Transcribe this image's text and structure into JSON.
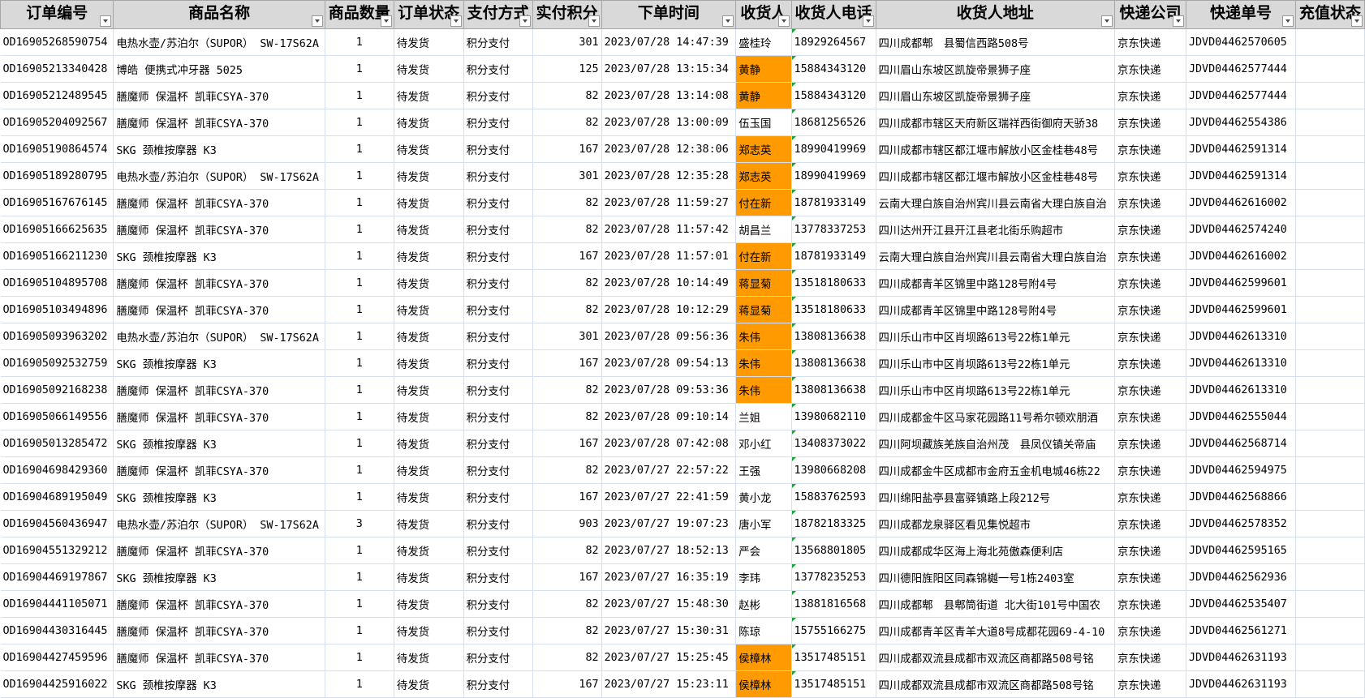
{
  "table": {
    "headers": [
      "订单编号",
      "商品名称",
      "商品数量",
      "订单状态",
      "支付方式",
      "实付积分",
      "下单时间",
      "收货人",
      "收货人电话",
      "收货人地址",
      "快递公司",
      "快递单号",
      "充值状态"
    ],
    "rows": [
      [
        "OD16905268590754",
        "电热水壶/苏泊尔（SUPOR） SW-17S62A",
        "1",
        "待发货",
        "积分支付",
        "301",
        "2023/07/28 14:47:39",
        "盛桂玲",
        "18929264567",
        "四川成都郫　县蜀信西路508号",
        "京东快递",
        "JDVD04462570605",
        ""
      ],
      [
        "OD16905213340428",
        "博皓 便携式冲牙器 5025",
        "1",
        "待发货",
        "积分支付",
        "125",
        "2023/07/28 13:15:34",
        "黄静",
        "15884343120",
        "四川眉山东坡区凯旋帝景狮子座",
        "京东快递",
        "JDVD04462577444",
        ""
      ],
      [
        "OD16905212489545",
        "膳魔师 保温杯 凯菲CSYA-370",
        "1",
        "待发货",
        "积分支付",
        "82",
        "2023/07/28 13:14:08",
        "黄静",
        "15884343120",
        "四川眉山东坡区凯旋帝景狮子座",
        "京东快递",
        "JDVD04462577444",
        ""
      ],
      [
        "OD16905204092567",
        "膳魔师 保温杯 凯菲CSYA-370",
        "1",
        "待发货",
        "积分支付",
        "82",
        "2023/07/28 13:00:09",
        "伍玉国",
        "18681256526",
        "四川成都市辖区天府新区瑞祥西街御府天骄38",
        "京东快递",
        "JDVD04462554386",
        ""
      ],
      [
        "OD16905190864574",
        "SKG 颈椎按摩器 K3",
        "1",
        "待发货",
        "积分支付",
        "167",
        "2023/07/28 12:38:06",
        "郑志英",
        "18990419969",
        "四川成都市辖区都江堰市解放小区金桂巷48号",
        "京东快递",
        "JDVD04462591314",
        ""
      ],
      [
        "OD16905189280795",
        "电热水壶/苏泊尔（SUPOR） SW-17S62A",
        "1",
        "待发货",
        "积分支付",
        "301",
        "2023/07/28 12:35:28",
        "郑志英",
        "18990419969",
        "四川成都市辖区都江堰市解放小区金桂巷48号",
        "京东快递",
        "JDVD04462591314",
        ""
      ],
      [
        "OD16905167676145",
        "膳魔师 保温杯 凯菲CSYA-370",
        "1",
        "待发货",
        "积分支付",
        "82",
        "2023/07/28 11:59:27",
        "付在新",
        "18781933149",
        "云南大理白族自治州宾川县云南省大理白族自治",
        "京东快递",
        "JDVD04462616002",
        ""
      ],
      [
        "OD16905166625635",
        "膳魔师 保温杯 凯菲CSYA-370",
        "1",
        "待发货",
        "积分支付",
        "82",
        "2023/07/28 11:57:42",
        "胡昌兰",
        "13778337253",
        "四川达州开江县开江县老北街乐购超市",
        "京东快递",
        "JDVD04462574240",
        ""
      ],
      [
        "OD16905166211230",
        "SKG 颈椎按摩器 K3",
        "1",
        "待发货",
        "积分支付",
        "167",
        "2023/07/28 11:57:01",
        "付在新",
        "18781933149",
        "云南大理白族自治州宾川县云南省大理白族自治",
        "京东快递",
        "JDVD04462616002",
        ""
      ],
      [
        "OD16905104895708",
        "膳魔师 保温杯 凯菲CSYA-370",
        "1",
        "待发货",
        "积分支付",
        "82",
        "2023/07/28 10:14:49",
        "蒋显菊",
        "13518180633",
        "四川成都青羊区锦里中路128号附4号",
        "京东快递",
        "JDVD04462599601",
        ""
      ],
      [
        "OD16905103494896",
        "膳魔师 保温杯 凯菲CSYA-370",
        "1",
        "待发货",
        "积分支付",
        "82",
        "2023/07/28 10:12:29",
        "蒋显菊",
        "13518180633",
        "四川成都青羊区锦里中路128号附4号",
        "京东快递",
        "JDVD04462599601",
        ""
      ],
      [
        "OD16905093963202",
        "电热水壶/苏泊尔（SUPOR） SW-17S62A",
        "1",
        "待发货",
        "积分支付",
        "301",
        "2023/07/28 09:56:36",
        "朱伟",
        "13808136638",
        "四川乐山市中区肖坝路613号22栋1单元",
        "京东快递",
        "JDVD04462613310",
        ""
      ],
      [
        "OD16905092532759",
        "SKG 颈椎按摩器 K3",
        "1",
        "待发货",
        "积分支付",
        "167",
        "2023/07/28 09:54:13",
        "朱伟",
        "13808136638",
        "四川乐山市中区肖坝路613号22栋1单元",
        "京东快递",
        "JDVD04462613310",
        ""
      ],
      [
        "OD16905092168238",
        "膳魔师 保温杯 凯菲CSYA-370",
        "1",
        "待发货",
        "积分支付",
        "82",
        "2023/07/28 09:53:36",
        "朱伟",
        "13808136638",
        "四川乐山市中区肖坝路613号22栋1单元",
        "京东快递",
        "JDVD04462613310",
        ""
      ],
      [
        "OD16905066149556",
        "膳魔师 保温杯 凯菲CSYA-370",
        "1",
        "待发货",
        "积分支付",
        "82",
        "2023/07/28 09:10:14",
        "兰姐",
        "13980682110",
        "四川成都金牛区马家花园路11号希尔顿欢朋酒",
        "京东快递",
        "JDVD04462555044",
        ""
      ],
      [
        "OD16905013285472",
        "SKG 颈椎按摩器 K3",
        "1",
        "待发货",
        "积分支付",
        "167",
        "2023/07/28 07:42:08",
        "邓小红",
        "13408373022",
        "四川阿坝藏族羌族自治州茂　县凤仪镇关帝庙",
        "京东快递",
        "JDVD04462568714",
        ""
      ],
      [
        "OD16904698429360",
        "膳魔师 保温杯 凯菲CSYA-370",
        "1",
        "待发货",
        "积分支付",
        "82",
        "2023/07/27 22:57:22",
        "王强",
        "13980668208",
        "四川成都金牛区成都市金府五金机电城46栋22",
        "京东快递",
        "JDVD04462594975",
        ""
      ],
      [
        "OD16904689195049",
        "SKG 颈椎按摩器 K3",
        "1",
        "待发货",
        "积分支付",
        "167",
        "2023/07/27 22:41:59",
        "黄小龙",
        "15883762593",
        "四川绵阳盐亭县富驿镇路上段212号",
        "京东快递",
        "JDVD04462568866",
        ""
      ],
      [
        "OD16904560436947",
        "电热水壶/苏泊尔（SUPOR） SW-17S62A",
        "3",
        "待发货",
        "积分支付",
        "903",
        "2023/07/27 19:07:23",
        "唐小军",
        "18782183325",
        "四川成都龙泉驿区看见集悦超市",
        "京东快递",
        "JDVD04462578352",
        ""
      ],
      [
        "OD16904551329212",
        "膳魔师 保温杯 凯菲CSYA-370",
        "1",
        "待发货",
        "积分支付",
        "82",
        "2023/07/27 18:52:13",
        "严会",
        "13568801805",
        "四川成都成华区海上海北苑傲森便利店",
        "京东快递",
        "JDVD04462595165",
        ""
      ],
      [
        "OD16904469197867",
        "SKG 颈椎按摩器 K3",
        "1",
        "待发货",
        "积分支付",
        "167",
        "2023/07/27 16:35:19",
        "李玮",
        "13778235253",
        "四川德阳旌阳区同森锦樾一号1栋2403室",
        "京东快递",
        "JDVD04462562936",
        ""
      ],
      [
        "OD16904441105071",
        "膳魔师 保温杯 凯菲CSYA-370",
        "1",
        "待发货",
        "积分支付",
        "82",
        "2023/07/27 15:48:30",
        "赵彬",
        "13881816568",
        "四川成都郫　县郫筒街道 北大街101号中国农",
        "京东快递",
        "JDVD04462535407",
        ""
      ],
      [
        "OD16904430316445",
        "膳魔师 保温杯 凯菲CSYA-370",
        "1",
        "待发货",
        "积分支付",
        "82",
        "2023/07/27 15:30:31",
        "陈琼",
        "15755166275",
        "四川成都青羊区青羊大道8号成都花园69-4-10",
        "京东快递",
        "JDVD04462561271",
        ""
      ],
      [
        "OD16904427459596",
        "膳魔师 保温杯 凯菲CSYA-370",
        "1",
        "待发货",
        "积分支付",
        "82",
        "2023/07/27 15:25:45",
        "侯樟林",
        "13517485151",
        "四川成都双流县成都市双流区商都路508号铭",
        "京东快递",
        "JDVD04462631193",
        ""
      ],
      [
        "OD16904425916022",
        "SKG 颈椎按摩器 K3",
        "1",
        "待发货",
        "积分支付",
        "167",
        "2023/07/27 15:23:11",
        "侯樟林",
        "13517485151",
        "四川成都双流县成都市双流区商都路508号铭",
        "京东快递",
        "JDVD04462631193",
        ""
      ]
    ],
    "highlighted_rows": [
      1,
      2,
      4,
      5,
      6,
      8,
      9,
      10,
      11,
      12,
      13,
      23,
      24
    ],
    "highlight_color": "#ff9a00",
    "header_bg": "#d9d9d9",
    "filter_icon": "filter-dropdown-icon"
  }
}
